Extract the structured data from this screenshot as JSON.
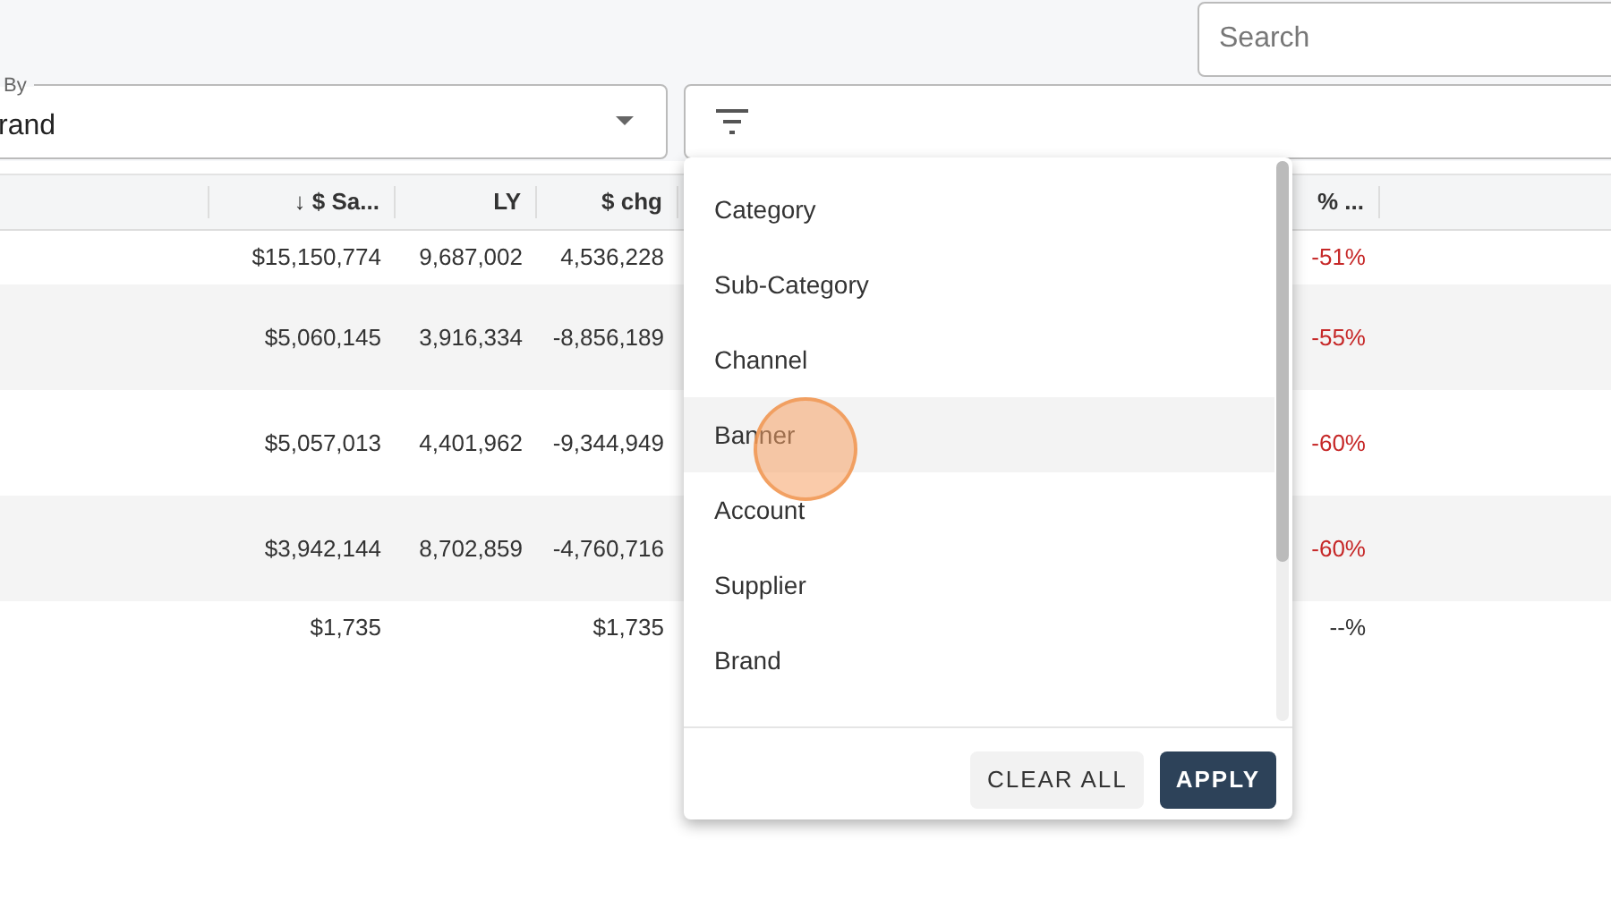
{
  "search": {
    "placeholder": "Search"
  },
  "group_by": {
    "label": "By",
    "value": "rand"
  },
  "table": {
    "columns": [
      "↓ $ Sa...",
      "LY",
      "$ chg",
      "% ..."
    ],
    "rows": [
      {
        "cells": [
          "$15,150,774",
          "9,687,002",
          "4,536,228",
          "-51%"
        ],
        "negative": true
      },
      {
        "cells": [
          "$5,060,145",
          "3,916,334",
          "-8,856,189",
          "-55%"
        ],
        "negative": true
      },
      {
        "cells": [
          "$5,057,013",
          "4,401,962",
          "-9,344,949",
          "-60%"
        ],
        "negative": true
      },
      {
        "cells": [
          "$3,942,144",
          "8,702,859",
          "-4,760,716",
          "-60%"
        ],
        "negative": true
      },
      {
        "cells": [
          "$1,735",
          "",
          "$1,735",
          "--%"
        ],
        "negative": false
      }
    ]
  },
  "filter_menu": {
    "items": [
      {
        "label": "Category",
        "hovered": false
      },
      {
        "label": "Sub-Category",
        "hovered": false
      },
      {
        "label": "Channel",
        "hovered": false
      },
      {
        "label": "Banner",
        "hovered": true
      },
      {
        "label": "Account",
        "hovered": false
      },
      {
        "label": "Supplier",
        "hovered": false
      },
      {
        "label": "Brand",
        "hovered": false
      }
    ],
    "buttons": [
      {
        "label": "CLEAR ALL",
        "kind": "secondary"
      },
      {
        "label": "APPLY",
        "kind": "primary"
      }
    ]
  }
}
